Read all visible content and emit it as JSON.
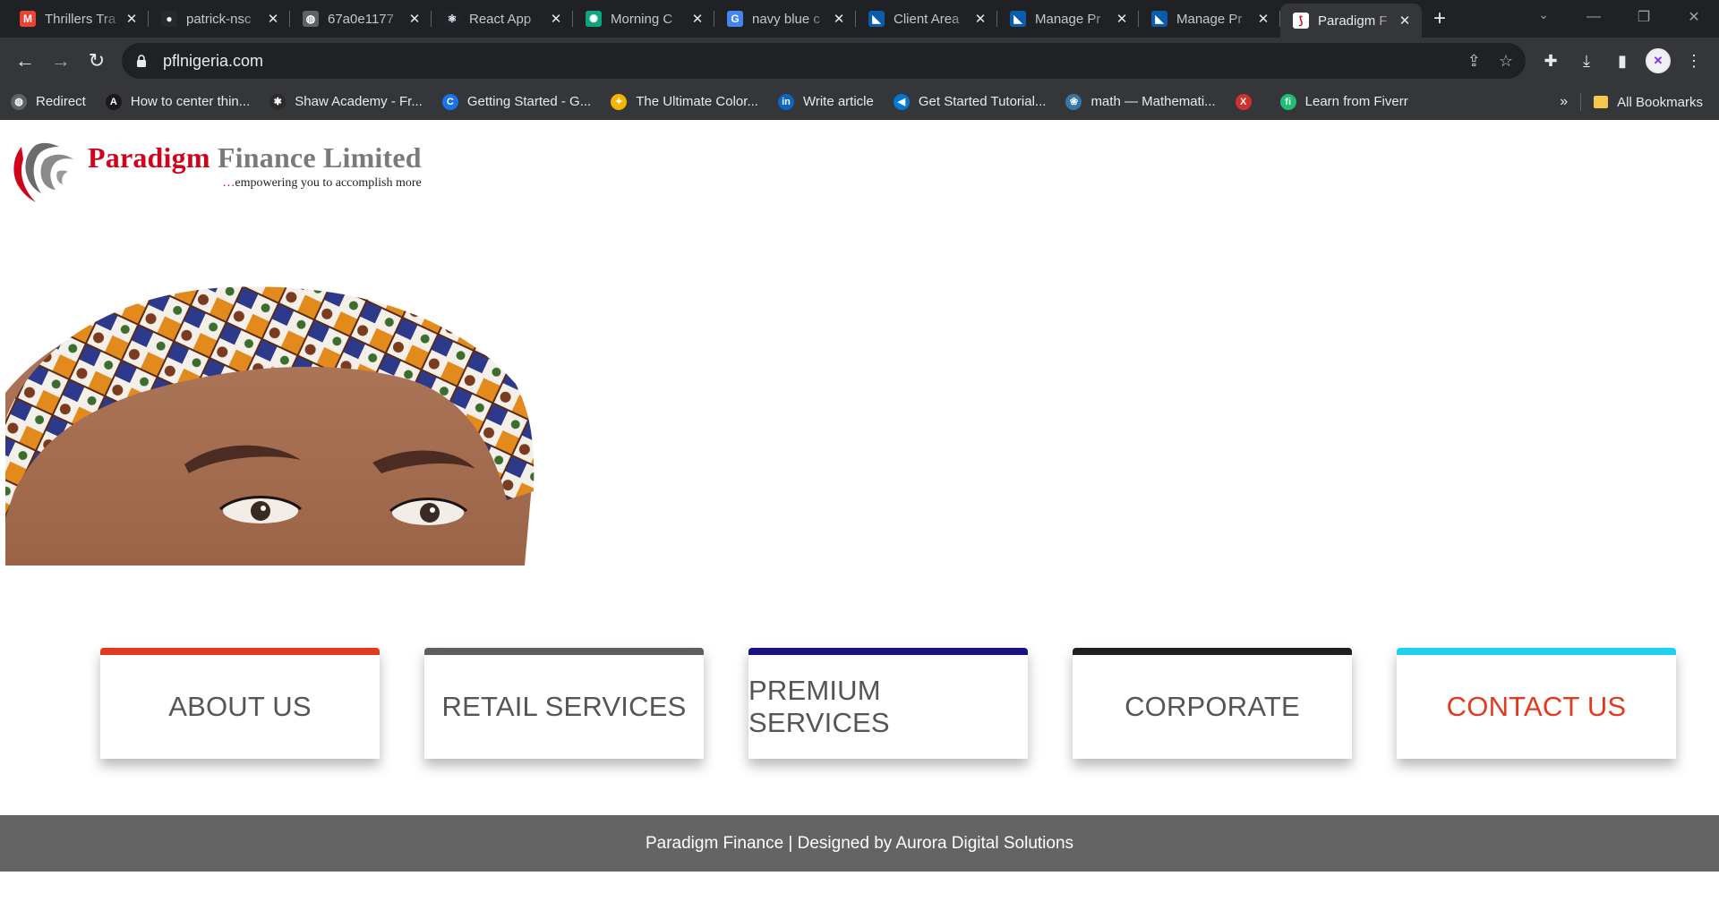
{
  "browser": {
    "tabs": [
      {
        "title": "Thrillers Tra",
        "icon": "gmail-icon",
        "color": "#ea4335",
        "glyph": "M"
      },
      {
        "title": "patrick-nsc",
        "icon": "github-icon",
        "color": "#24292e",
        "glyph": "●"
      },
      {
        "title": "67a0e1177",
        "icon": "globe-icon",
        "color": "#5f6368",
        "glyph": "◍"
      },
      {
        "title": "React App",
        "icon": "react-icon",
        "color": "#20232a",
        "glyph": "⚛"
      },
      {
        "title": "Morning C",
        "icon": "chatgpt-icon",
        "color": "#10a37f",
        "glyph": "✺"
      },
      {
        "title": "navy blue c",
        "icon": "google-icon",
        "color": "#4285f4",
        "glyph": "G"
      },
      {
        "title": "Client Area",
        "icon": "client-area-icon",
        "color": "#0b5cad",
        "glyph": "◣"
      },
      {
        "title": "Manage Pr",
        "icon": "manage-icon",
        "color": "#0b5cad",
        "glyph": "◣"
      },
      {
        "title": "Manage Pr",
        "icon": "manage-icon",
        "color": "#0b5cad",
        "glyph": "◣"
      },
      {
        "title": "Paradigm F",
        "icon": "paradigm-icon",
        "color": "#ffffff",
        "glyph": "⟆"
      }
    ],
    "active_tab_index": 9,
    "url": "pflnigeria.com",
    "bookmarks": [
      {
        "label": "Redirect",
        "icon": "globe-icon",
        "color": "#5f6368",
        "glyph": "◍"
      },
      {
        "label": "How to center thin...",
        "icon": "angular-icon",
        "color": "#1a1a1a",
        "glyph": "A"
      },
      {
        "label": "Shaw Academy - Fr...",
        "icon": "shaw-academy-icon",
        "color": "#2b2b2b",
        "glyph": "✱"
      },
      {
        "label": "Getting Started - G...",
        "icon": "c-icon",
        "color": "#1a73e8",
        "glyph": "C"
      },
      {
        "label": "The Ultimate Color...",
        "icon": "bulb-icon",
        "color": "#f4b400",
        "glyph": "✦"
      },
      {
        "label": "Write article",
        "icon": "linkedin-icon",
        "color": "#0a66c2",
        "glyph": "in"
      },
      {
        "label": "Get Started Tutorial...",
        "icon": "vscode-icon",
        "color": "#0078d7",
        "glyph": "◀"
      },
      {
        "label": "math — Mathemati...",
        "icon": "python-icon",
        "color": "#3776ab",
        "glyph": "❀"
      },
      {
        "label": "",
        "icon": "x-icon",
        "color": "#d32f2f",
        "glyph": "X"
      },
      {
        "label": "Learn from Fiverr",
        "icon": "fiverr-icon",
        "color": "#1dbf73",
        "glyph": "fi"
      }
    ],
    "all_bookmarks": "All Bookmarks",
    "overflow": "»"
  },
  "site": {
    "brand_red": "Paradigm",
    "brand_grey": "Finance Limited",
    "tagline_dots": "…",
    "tagline": "empowering you to accomplish more",
    "nav_cards": [
      {
        "label": "ABOUT US",
        "accent": "#e23a1e",
        "text_color": "#555555"
      },
      {
        "label": "RETAIL SERVICES",
        "accent": "#5e5e5e",
        "text_color": "#555555"
      },
      {
        "label": "PREMIUM SERVICES",
        "accent": "#1a1380",
        "text_color": "#555555"
      },
      {
        "label": "CORPORATE",
        "accent": "#1f1f1f",
        "text_color": "#555555"
      },
      {
        "label": "CONTACT US",
        "accent": "#1fcff0",
        "text_color": "#e23a1e"
      }
    ],
    "footer": "Paradigm Finance | Designed by Aurora Digital Solutions"
  }
}
